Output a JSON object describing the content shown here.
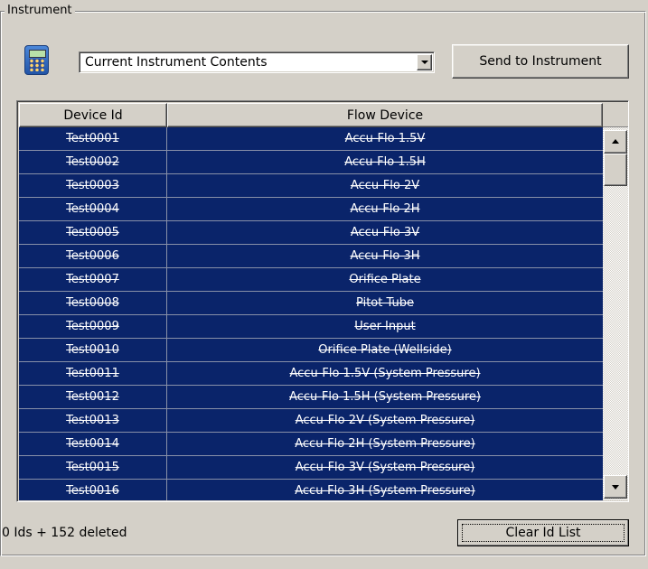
{
  "group": {
    "title": "Instrument"
  },
  "icons": {
    "device": "handheld-instrument-icon"
  },
  "selector": {
    "value": "Current Instrument Contents"
  },
  "send_button": {
    "label": "Send to Instrument"
  },
  "table": {
    "columns": [
      "Device Id",
      "Flow Device"
    ],
    "rows": [
      {
        "id": "Test0001",
        "flow": "Accu-Flo 1.5V"
      },
      {
        "id": "Test0002",
        "flow": "Accu-Flo 1.5H"
      },
      {
        "id": "Test0003",
        "flow": "Accu-Flo 2V"
      },
      {
        "id": "Test0004",
        "flow": "Accu-Flo 2H"
      },
      {
        "id": "Test0005",
        "flow": "Accu-Flo 3V"
      },
      {
        "id": "Test0006",
        "flow": "Accu-Flo 3H"
      },
      {
        "id": "Test0007",
        "flow": "Orifice Plate"
      },
      {
        "id": "Test0008",
        "flow": "Pitot Tube"
      },
      {
        "id": "Test0009",
        "flow": "User Input"
      },
      {
        "id": "Test0010",
        "flow": "Orifice Plate (Wellside)"
      },
      {
        "id": "Test0011",
        "flow": "Accu-Flo 1.5V (System Pressure)"
      },
      {
        "id": "Test0012",
        "flow": "Accu-Flo 1.5H (System Pressure)"
      },
      {
        "id": "Test0013",
        "flow": "Accu-Flo 2V (System Pressure)"
      },
      {
        "id": "Test0014",
        "flow": "Accu-Flo 2H (System Pressure)"
      },
      {
        "id": "Test0015",
        "flow": "Accu-Flo 3V (System Pressure)"
      },
      {
        "id": "Test0016",
        "flow": "Accu-Flo 3H (System Pressure)"
      }
    ]
  },
  "status": {
    "text": "0 Ids + 152 deleted"
  },
  "clear_button": {
    "label": "Clear Id List"
  },
  "colors": {
    "selection": "#0a246a",
    "face": "#d4d0c8"
  }
}
